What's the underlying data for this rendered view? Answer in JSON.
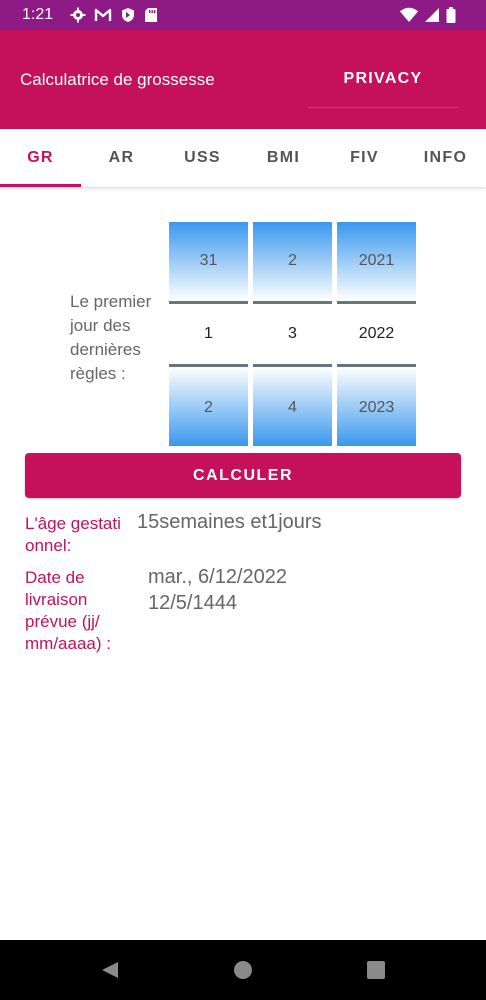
{
  "status": {
    "time": "1:21"
  },
  "appbar": {
    "title": "Calculatrice de grossesse",
    "privacy": "PRIVACY"
  },
  "tabs": [
    {
      "label": "GR",
      "active": true
    },
    {
      "label": "AR"
    },
    {
      "label": "USS"
    },
    {
      "label": "BMI"
    },
    {
      "label": "FIV"
    },
    {
      "label": "INFO"
    }
  ],
  "form": {
    "prompt": "Le premier jour des dernières règles :",
    "picker": {
      "day": {
        "prev": "31",
        "selected": "1",
        "next": "2"
      },
      "month": {
        "prev": "2",
        "selected": "3",
        "next": "4"
      },
      "year": {
        "prev": "2021",
        "selected": "2022",
        "next": "2023"
      }
    },
    "button": "CALCULER"
  },
  "results": {
    "age_label": "L'âge gestati onnel:",
    "age_value": "15semaines et1jours",
    "delivery_label": "Date de livraison prévue (jj/ mm/aaaa) :",
    "delivery_value_1": "mar., 6/12/2022",
    "delivery_value_2": "12/5/1444"
  },
  "colors": {
    "primary": "#c5115b",
    "statusbar": "#8e1a86",
    "picker_blue": "#3a98ee"
  },
  "icons": [
    "settings-icon",
    "gmail-icon",
    "shield-icon",
    "sd-card-icon",
    "wifi-icon",
    "signal-icon",
    "battery-icon",
    "back-icon",
    "home-icon",
    "recents-icon"
  ]
}
